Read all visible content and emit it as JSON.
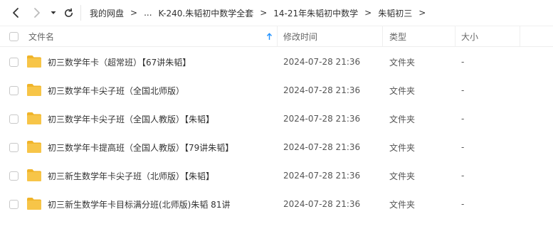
{
  "toolbar": {
    "breadcrumbs": [
      "我的网盘",
      "K-240.朱韬初中数学全套",
      "14-21年朱韬初中数学",
      "朱韬初三"
    ],
    "ellipsis": "..."
  },
  "table": {
    "columns": {
      "name": "文件名",
      "modified": "修改时间",
      "type": "类型",
      "size": "大小"
    },
    "sort": "name-ascending",
    "rows": [
      {
        "name": "初三数学年卡（超常班）【67讲朱韬】",
        "modified": "2024-07-28 21:36",
        "type": "文件夹",
        "size": "-"
      },
      {
        "name": "初三数学年卡尖子班（全国北师版）",
        "modified": "2024-07-28 21:36",
        "type": "文件夹",
        "size": "-"
      },
      {
        "name": "初三数学年卡尖子班（全国人教版）【朱韬】",
        "modified": "2024-07-28 21:36",
        "type": "文件夹",
        "size": "-"
      },
      {
        "name": "初三数学年卡提高班（全国人教版）【79讲朱韬】",
        "modified": "2024-07-28 21:36",
        "type": "文件夹",
        "size": "-"
      },
      {
        "name": "初三新生数学年卡尖子班（北师版）【朱韬】",
        "modified": "2024-07-28 21:36",
        "type": "文件夹",
        "size": "-"
      },
      {
        "name": "初三新生数学年卡目标满分班(北师版)朱韬 81讲",
        "modified": "2024-07-28 21:36",
        "type": "文件夹",
        "size": "-"
      }
    ]
  },
  "colors": {
    "folder": "#f7c548",
    "folder_dark": "#f0b429",
    "sort_arrow": "#1e90ff",
    "border": "#eeeeee"
  }
}
